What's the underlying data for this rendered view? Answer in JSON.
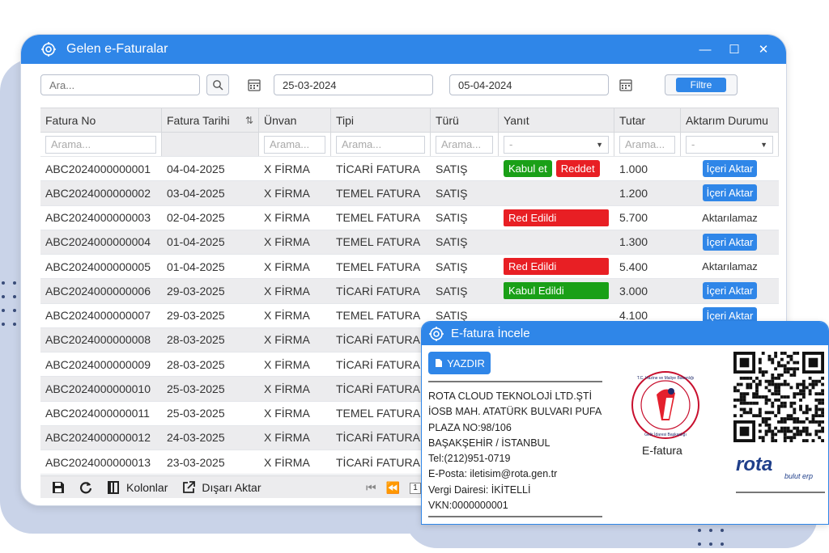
{
  "window": {
    "title": "Gelen e-Faturalar",
    "minimize_icon": "minimize-icon",
    "maximize_icon": "maximize-icon",
    "close_icon": "close-icon",
    "app_icon": "gear-icon"
  },
  "filters": {
    "search_placeholder": "Ara...",
    "start_date": "25-03-2024",
    "end_date": "05-04-2024",
    "filter_label": "Filtre"
  },
  "columns": [
    "Fatura No",
    "Fatura Tarihi",
    "Ünvan",
    "Tipi",
    "Türü",
    "Yanıt",
    "Tutar",
    "Aktarım Durumu"
  ],
  "column_filters": {
    "fatura_no": "Arama...",
    "unvan": "Arama...",
    "tipi": "Arama...",
    "turu": "Arama...",
    "yanit": "-",
    "tutar": "Arama...",
    "aktarim": "-"
  },
  "labels": {
    "kabul_et": "Kabul et",
    "reddet": "Reddet",
    "red_edildi": "Red Edildi",
    "kabul_edildi": "Kabul Edildi",
    "iceri_aktar": "İçeri Aktar",
    "aktarilamaz": "Aktarılamaz"
  },
  "rows": [
    {
      "no": "ABC2024000000001",
      "date": "04-04-2025",
      "unvan": "X FİRMA",
      "tipi": "TİCARİ FATURA",
      "turu": "SATIŞ",
      "yanit": "buttons",
      "tutar": "1.000",
      "aktarim": "button"
    },
    {
      "no": "ABC2024000000002",
      "date": "03-04-2025",
      "unvan": "X FİRMA",
      "tipi": "TEMEL FATURA",
      "turu": "SATIŞ",
      "yanit": "",
      "tutar": "1.200",
      "aktarim": "button"
    },
    {
      "no": "ABC2024000000003",
      "date": "02-04-2025",
      "unvan": "X FİRMA",
      "tipi": "TEMEL FATURA",
      "turu": "SATIŞ",
      "yanit": "red",
      "tutar": "5.700",
      "aktarim": "text"
    },
    {
      "no": "ABC2024000000004",
      "date": "01-04-2025",
      "unvan": "X FİRMA",
      "tipi": "TEMEL FATURA",
      "turu": "SATIŞ",
      "yanit": "",
      "tutar": "1.300",
      "aktarim": "button"
    },
    {
      "no": "ABC2024000000005",
      "date": "01-04-2025",
      "unvan": "X FİRMA",
      "tipi": "TEMEL FATURA",
      "turu": "SATIŞ",
      "yanit": "red",
      "tutar": "5.400",
      "aktarim": "text"
    },
    {
      "no": "ABC2024000000006",
      "date": "29-03-2025",
      "unvan": "X FİRMA",
      "tipi": "TİCARİ FATURA",
      "turu": "SATIŞ",
      "yanit": "green",
      "tutar": "3.000",
      "aktarim": "button"
    },
    {
      "no": "ABC2024000000007",
      "date": "29-03-2025",
      "unvan": "X FİRMA",
      "tipi": "TEMEL FATURA",
      "turu": "SATIŞ",
      "yanit": "",
      "tutar": "4.100",
      "aktarim": "button"
    },
    {
      "no": "ABC2024000000008",
      "date": "28-03-2025",
      "unvan": "X FİRMA",
      "tipi": "TİCARİ FATURA",
      "turu": "",
      "yanit": "",
      "tutar": "",
      "aktarim": ""
    },
    {
      "no": "ABC2024000000009",
      "date": "28-03-2025",
      "unvan": "X FİRMA",
      "tipi": "TİCARİ FATURA",
      "turu": "",
      "yanit": "",
      "tutar": "",
      "aktarim": ""
    },
    {
      "no": "ABC2024000000010",
      "date": "25-03-2025",
      "unvan": "X FİRMA",
      "tipi": "TİCARİ FATURA",
      "turu": "",
      "yanit": "",
      "tutar": "",
      "aktarim": ""
    },
    {
      "no": "ABC2024000000011",
      "date": "25-03-2025",
      "unvan": "X FİRMA",
      "tipi": "TEMEL FATURA",
      "turu": "",
      "yanit": "",
      "tutar": "",
      "aktarim": ""
    },
    {
      "no": "ABC2024000000012",
      "date": "24-03-2025",
      "unvan": "X FİRMA",
      "tipi": "TİCARİ FATURA",
      "turu": "",
      "yanit": "",
      "tutar": "",
      "aktarim": ""
    },
    {
      "no": "ABC2024000000013",
      "date": "23-03-2025",
      "unvan": "X FİRMA",
      "tipi": "TİCARİ FATURA",
      "turu": "",
      "yanit": "",
      "tutar": "",
      "aktarim": ""
    }
  ],
  "footer": {
    "save_icon": "save-icon",
    "refresh_icon": "refresh-icon",
    "columns_icon": "columns-icon",
    "columns_label": "Kolonlar",
    "export_icon": "export-icon",
    "export_label": "Dışarı Aktar",
    "page": "1"
  },
  "popup": {
    "title": "E-fatura İncele",
    "print_label": "YAZDIR",
    "company_lines": [
      "ROTA CLOUD TEKNOLOJİ LTD.ŞTİ",
      "İOSB MAH. ATATÜRK BULVARI PUFA",
      "PLAZA NO:98/106",
      "BAŞAKŞEHİR / İSTANBUL",
      "Tel:(212)951-0719",
      "E-Posta: iletisim@rota.gen.tr",
      "Vergi Dairesi: İKİTELLİ",
      "VKN:0000000001"
    ],
    "efatura_label": "E-fatura",
    "seal_top_text": "T.C. Hazine ve Maliye Bakanlığı",
    "seal_bottom_text": "Gelir İdaresi Başkanlığı",
    "logo_text": "rota",
    "logo_sub": "bulut erp"
  },
  "colors": {
    "accent": "#2f86e8",
    "green": "#1aa017",
    "red": "#e81f24"
  }
}
